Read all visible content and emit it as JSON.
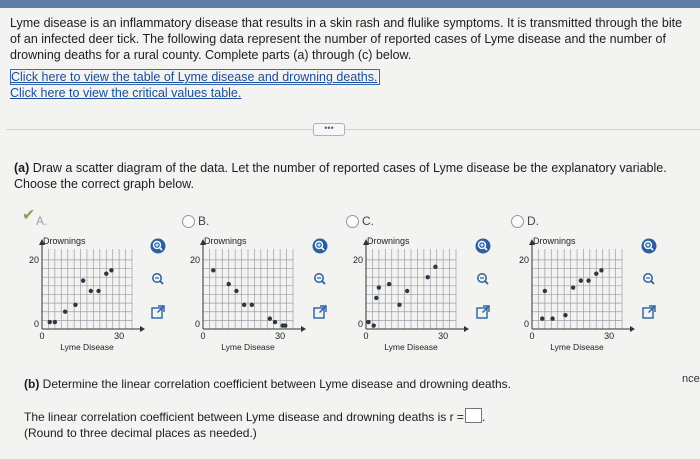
{
  "intro_text": "Lyme disease is an inflammatory disease that results in a skin rash and flulike symptoms. It is transmitted through the bite of an infected deer tick. The following data represent the number of reported cases of Lyme disease and the number of drowning deaths for a rural county. Complete parts (a) through (c) below.",
  "links": {
    "table": "Click here to view the table of Lyme disease and drowning deaths.",
    "critical": "Click here to view the critical values table."
  },
  "more_button": "•••",
  "part_a": {
    "label": "(a)",
    "text": "Draw a scatter diagram of the data. Let the number of reported cases of Lyme disease be the explanatory variable. Choose the correct graph below."
  },
  "options": [
    {
      "letter": "A.",
      "selected": true
    },
    {
      "letter": "B.",
      "selected": false
    },
    {
      "letter": "C.",
      "selected": false
    },
    {
      "letter": "D.",
      "selected": false
    }
  ],
  "graph_labels": {
    "ylabel": "Drownings",
    "xlabel": "Lyme Disease",
    "ytick_top": "20",
    "ytick_zero": "0",
    "xtick_zero": "0",
    "xtick_30": "30"
  },
  "chart_data": [
    {
      "type": "scatter",
      "option": "A",
      "x": [
        3,
        5,
        9,
        13,
        16,
        19,
        22,
        25,
        27
      ],
      "y": [
        2,
        2,
        5,
        7,
        14,
        11,
        11,
        16,
        17
      ],
      "xlim": [
        0,
        35
      ],
      "ylim": [
        0,
        22
      ]
    },
    {
      "type": "scatter",
      "option": "B",
      "x": [
        4,
        10,
        13,
        16,
        19,
        26,
        28,
        31,
        32
      ],
      "y": [
        17,
        13,
        11,
        7,
        7,
        3,
        2,
        1,
        1
      ],
      "xlim": [
        0,
        35
      ],
      "ylim": [
        0,
        22
      ]
    },
    {
      "type": "scatter",
      "option": "C",
      "x": [
        1,
        3,
        4,
        5,
        9,
        13,
        16,
        24,
        27
      ],
      "y": [
        2,
        1,
        9,
        12,
        13,
        7,
        11,
        15,
        18
      ],
      "xlim": [
        0,
        35
      ],
      "ylim": [
        0,
        22
      ]
    },
    {
      "type": "scatter",
      "option": "D",
      "x": [
        4,
        5,
        8,
        13,
        16,
        19,
        22,
        25,
        27
      ],
      "y": [
        3,
        11,
        3,
        4,
        12,
        14,
        14,
        16,
        17
      ],
      "xlim": [
        0,
        35
      ],
      "ylim": [
        0,
        22
      ]
    }
  ],
  "colors": {
    "point": "#2f3640",
    "grid": "#9aa0a8",
    "accent": "#1a4d9c",
    "check": "#8aa652"
  },
  "icons": [
    "zoom-in-icon",
    "zoom-out-icon",
    "popout-icon"
  ],
  "part_b": {
    "label": "(b)",
    "text": "Determine the linear correlation coefficient between Lyme disease and drowning deaths."
  },
  "r_sentence": "The linear correlation coefficient between Lyme disease and drowning deaths is r =",
  "r_period": ".",
  "r_note": "(Round to three decimal places as needed.)",
  "edge_text": "nce"
}
